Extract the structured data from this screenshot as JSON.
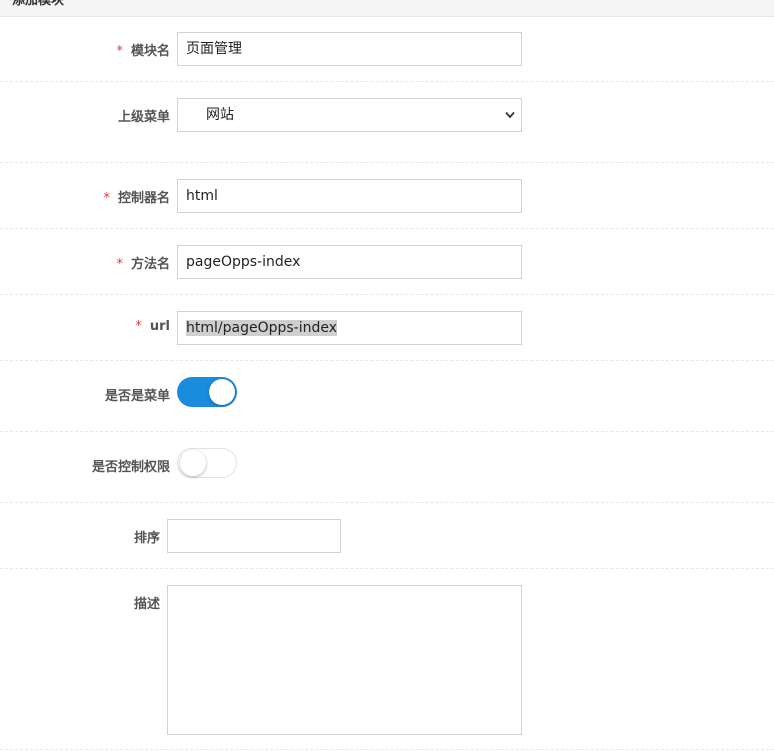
{
  "header": {
    "title": "添加模块"
  },
  "form": {
    "module_name": {
      "required": "*",
      "label": "模块名",
      "value": "页面管理"
    },
    "parent_menu": {
      "label": "上级菜单",
      "value": "网站"
    },
    "controller": {
      "required": "*",
      "label": "控制器名",
      "value": "html"
    },
    "method": {
      "required": "*",
      "label": "方法名",
      "value": "pageOpps-index"
    },
    "url": {
      "required": "*",
      "label": "url",
      "value": "html/pageOpps-index"
    },
    "is_menu": {
      "label": "是否是菜单",
      "on": true
    },
    "is_permission": {
      "label": "是否控制权限",
      "on": false
    },
    "sort": {
      "label": "排序",
      "value": ""
    },
    "description": {
      "label": "描述",
      "value": ""
    }
  },
  "colors": {
    "accent": "#1a8cde",
    "required": "#e4393c"
  }
}
